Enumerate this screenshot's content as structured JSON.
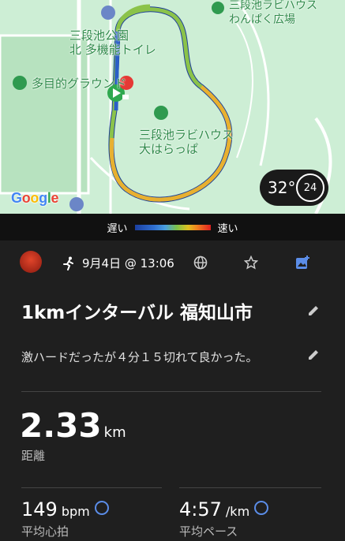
{
  "map": {
    "labels": {
      "park_toilet": "三段池公園\n北 多機能トイレ",
      "ground": "多目的グラウンド",
      "square": "三段池ラビハウス\nわんぱく広場",
      "field": "三段池ラビハウス\n大はらっぱ"
    },
    "google_letters": [
      "G",
      "o",
      "o",
      "g",
      "l",
      "e"
    ],
    "google_colors": [
      "#4285F4",
      "#EA4335",
      "#FBBC05",
      "#4285F4",
      "#34A853",
      "#EA4335"
    ],
    "weather": {
      "temp": "32°",
      "wind": "24"
    }
  },
  "legend": {
    "slow": "遅い",
    "fast": "速い"
  },
  "activity": {
    "date": "9月4日 @ 13:06",
    "title": "1kmインターバル 福知山市",
    "description": "激ハードだったが４分１５切れて良かった。",
    "distance": {
      "value": "2.33",
      "unit": "km",
      "label": "距離"
    },
    "heart_rate": {
      "value": "149",
      "unit": "bpm",
      "label": "平均心拍"
    },
    "pace": {
      "value": "4:57",
      "unit": "/km",
      "label": "平均ペース"
    }
  },
  "colors": {
    "route_slow": "#2b5fc7",
    "route_mid": "#8bc34a",
    "route_fast": "#e8b030",
    "icon_accent": "#5b8de8"
  }
}
